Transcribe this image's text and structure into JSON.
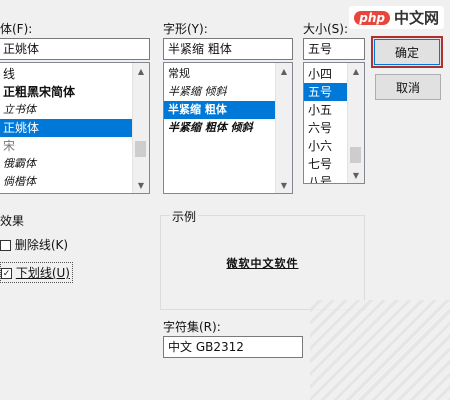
{
  "watermark": {
    "brand": "php",
    "site": "中文网"
  },
  "font": {
    "label": "体(F):",
    "value": "正姚体",
    "items": [
      "线",
      "正粗黑宋简体",
      "立书体",
      "正姚体",
      "宋",
      "俄霸体",
      "倘楷体"
    ],
    "selected_index": 3
  },
  "style": {
    "label": "字形(Y):",
    "value": "半紧缩 粗体",
    "items": [
      "常规",
      "半紧缩 倾斜",
      "半紧缩 粗体",
      "半紧缩 粗体 倾斜"
    ],
    "selected_index": 2
  },
  "size": {
    "label": "大小(S):",
    "value": "五号",
    "items": [
      "小四",
      "五号",
      "小五",
      "六号",
      "小六",
      "七号",
      "八号"
    ],
    "selected_index": 1
  },
  "buttons": {
    "ok": "确定",
    "cancel": "取消"
  },
  "effects": {
    "label": "效果",
    "strikeout": {
      "label": "删除线(K)",
      "checked": false
    },
    "underline": {
      "label": "下划线(U)",
      "checked": true
    }
  },
  "sample": {
    "label": "示例",
    "text": "微软中文软件"
  },
  "charset": {
    "label": "字符集(R):",
    "value": "中文 GB2312"
  },
  "colors": {
    "selection": "#0078d7",
    "default_border": "#b03030"
  }
}
